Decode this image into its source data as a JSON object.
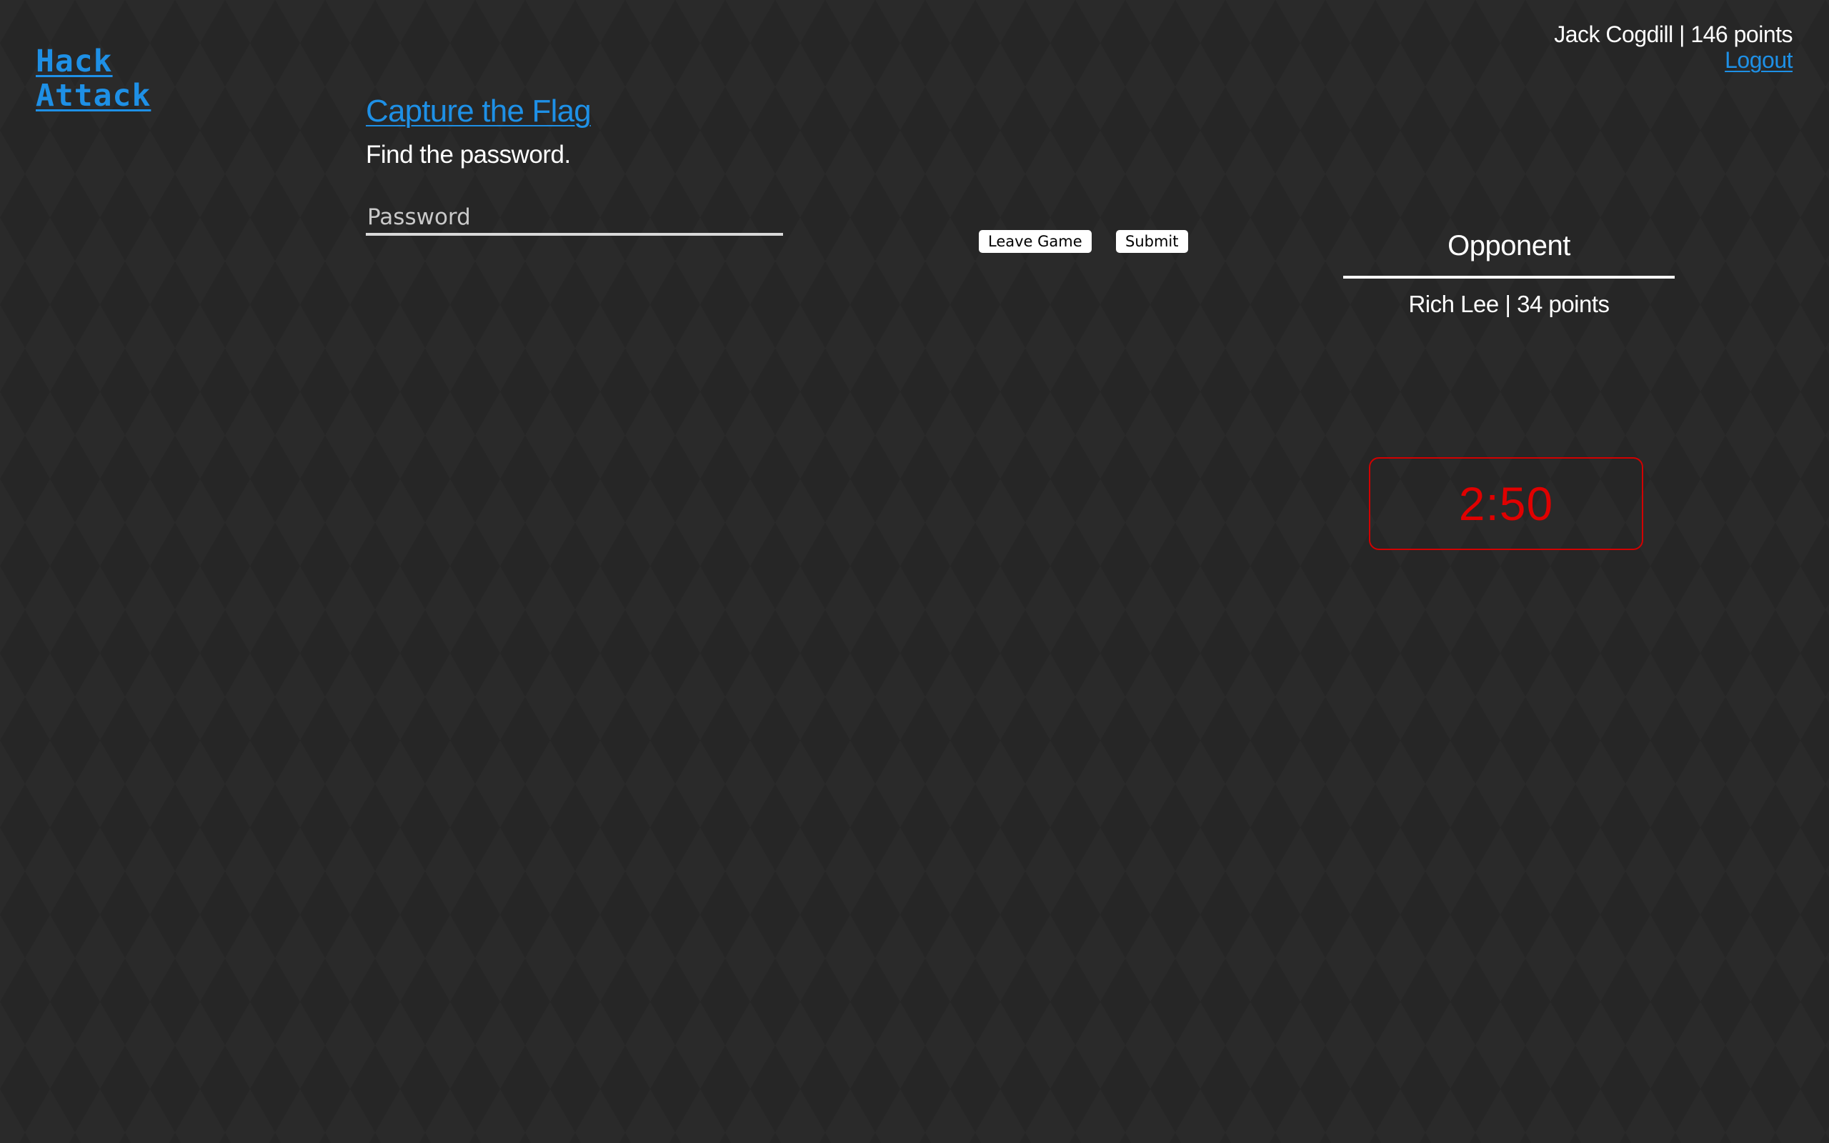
{
  "logo": {
    "line1": "Hack",
    "line2": "Attack"
  },
  "user": {
    "summary": "Jack Cogdill | 146 points",
    "logout_label": "Logout"
  },
  "game": {
    "title": "Capture the Flag",
    "instruction": "Find the password.",
    "password_placeholder": "Password",
    "password_value": ""
  },
  "buttons": {
    "leave_label": "Leave Game",
    "submit_label": "Submit"
  },
  "opponent": {
    "heading": "Opponent",
    "info": "Rich Lee | 34 points"
  },
  "timer": {
    "value": "2:50"
  },
  "colors": {
    "background": "#262626",
    "link_accent": "#1e90e6",
    "timer_red": "#e00000",
    "text": "#ffffff"
  }
}
